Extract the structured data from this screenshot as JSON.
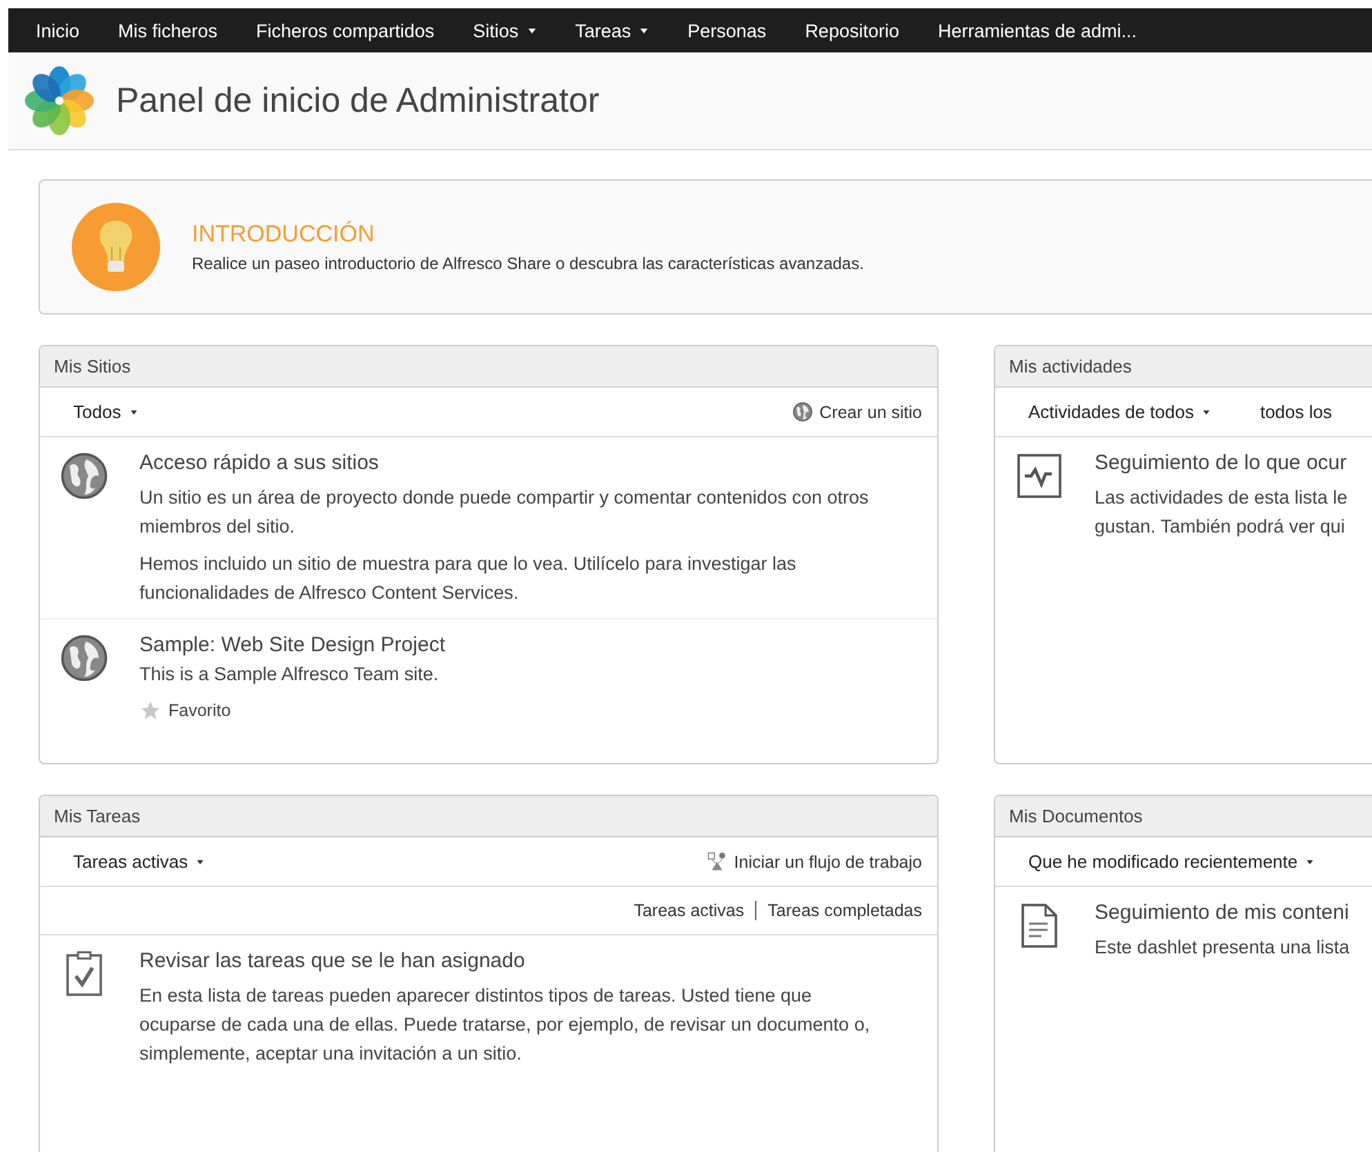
{
  "nav": [
    {
      "label": "Inicio",
      "dropdown": false
    },
    {
      "label": "Mis ficheros",
      "dropdown": false
    },
    {
      "label": "Ficheros compartidos",
      "dropdown": false
    },
    {
      "label": "Sitios",
      "dropdown": true
    },
    {
      "label": "Tareas",
      "dropdown": true
    },
    {
      "label": "Personas",
      "dropdown": false
    },
    {
      "label": "Repositorio",
      "dropdown": false
    },
    {
      "label": "Herramientas de admi...",
      "dropdown": false
    }
  ],
  "header": {
    "title": "Panel de inicio de Administrator"
  },
  "intro": {
    "title": "INTRODUCCIÓN",
    "text": "Realice un paseo introductorio de Alfresco Share o descubra las características avanzadas."
  },
  "dashlets": [
    {
      "title": "Mis Sitios",
      "filters": [
        {
          "label": "Todos",
          "dropdown": true
        }
      ],
      "action": {
        "label": "Crear un sitio"
      },
      "items": [
        {
          "kind": "info",
          "title": "Acceso rápido a sus sitios",
          "paragraphs": [
            "Un sitio es un área de proyecto donde puede compartir y comentar contenidos con otros miembros del sitio.",
            "Hemos incluido un sitio de muestra para que lo vea. Utilícelo para investigar las funcionalidades de Alfresco Content Services."
          ]
        },
        {
          "kind": "site",
          "title": "Sample: Web Site Design Project",
          "description": "This is a Sample Alfresco Team site.",
          "favorite": {
            "label": "Favorito",
            "on": false
          }
        }
      ]
    },
    {
      "title": "Mis actividades",
      "filters": [
        {
          "label": "Actividades de todos",
          "dropdown": true
        },
        {
          "label": "todos los",
          "dropdown": false
        }
      ],
      "items": [
        {
          "kind": "info",
          "title": "Seguimiento de lo que ocur",
          "lines": [
            "Las actividades de esta lista le",
            "gustan. También podrá ver qui"
          ]
        }
      ]
    },
    {
      "title": "Mis Tareas",
      "filters": [
        {
          "label": "Tareas activas",
          "dropdown": true
        }
      ],
      "action": {
        "label": "Iniciar un flujo de trabajo"
      },
      "links": [
        "Tareas activas",
        "Tareas completadas"
      ],
      "items": [
        {
          "kind": "info",
          "title": "Revisar las tareas que se le han asignado",
          "paragraphs": [
            "En esta lista de tareas pueden aparecer distintos tipos de tareas. Usted tiene que ocuparse de cada una de ellas. Puede tratarse, por ejemplo, de revisar un documento o, simplemente, aceptar una invitación a un sitio."
          ]
        }
      ]
    },
    {
      "title": "Mis Documentos",
      "filters": [
        {
          "label": "Que he modificado recientemente",
          "dropdown": true
        }
      ],
      "items": [
        {
          "kind": "info",
          "title": "Seguimiento de mis conteni",
          "lines": [
            "Este dashlet presenta una lista"
          ]
        }
      ]
    }
  ]
}
